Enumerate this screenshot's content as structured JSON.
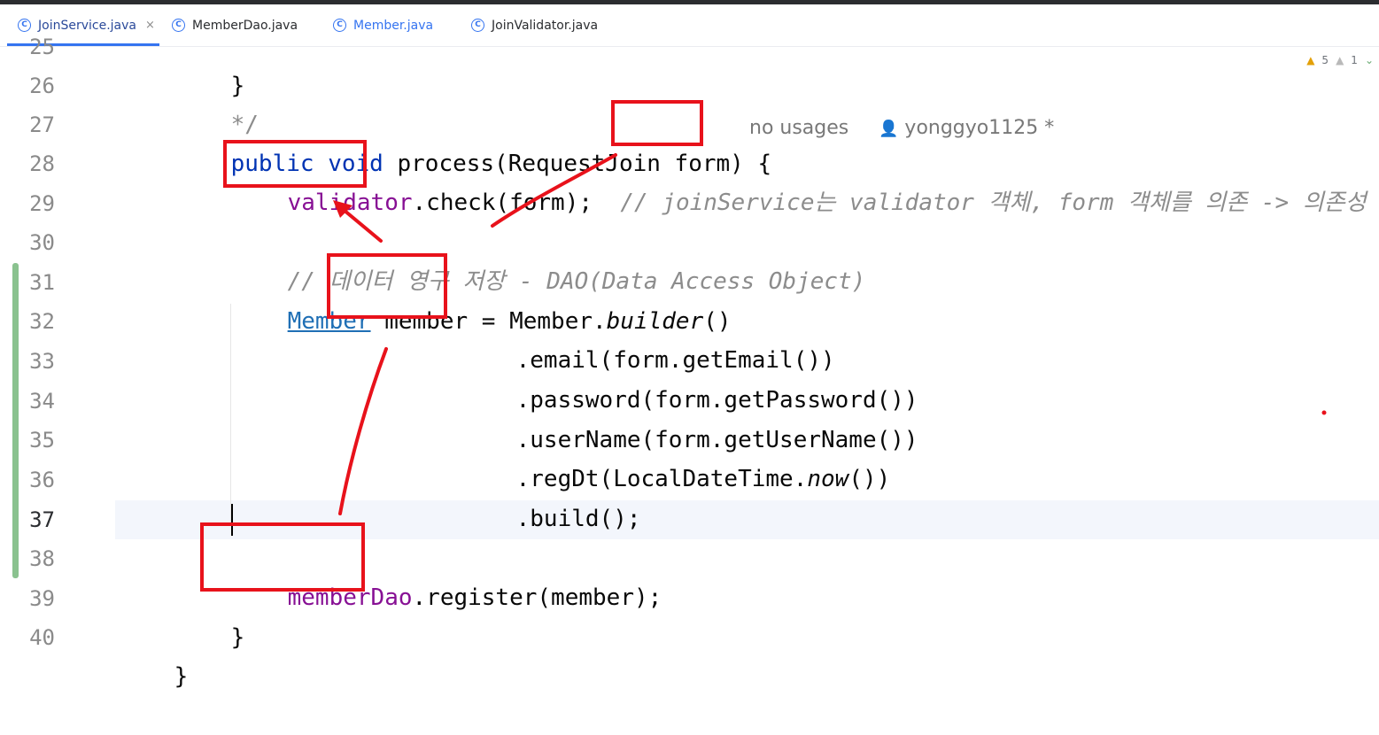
{
  "tabs": [
    {
      "label": "JoinService.java",
      "active": true
    },
    {
      "label": "MemberDao.java",
      "active": false
    },
    {
      "label": "Member.java",
      "active": false
    },
    {
      "label": "JoinValidator.java",
      "active": false
    }
  ],
  "tab_close_glyph": "×",
  "inspections": {
    "warnings": "5",
    "weak_warnings": "1"
  },
  "gutter": {
    "line_numbers": [
      "25",
      "26",
      "27",
      "28",
      "29",
      "30",
      "31",
      "32",
      "33",
      "34",
      "35",
      "36",
      "37",
      "38",
      "39",
      "40"
    ],
    "current_line": "37"
  },
  "code": {
    "l25_brace": "}",
    "l26_comment_end": "*/",
    "l27_public": "public",
    "l27_void": "void",
    "l27_signature": "process(RequestJoin form) {",
    "l27_hint_usages": "no usages",
    "l27_hint_author": "yonggyo1125 *",
    "l28_field": "validator",
    "l28_call": ".check(form);",
    "l28_comment": "// joinService는 validator 객체, form 객체를 의존 -> 의존성",
    "l30_comment": "// 데이터 영구 저장 - DAO(Data Access Object)",
    "l31_type": "Member",
    "l31_decl": " member = Member.",
    "l31_builder": "builder",
    "l31_end": "()",
    "l32": ".email(form.getEmail())",
    "l33": ".password(form.getPassword())",
    "l34": ".userName(form.getUserName())",
    "l35_start": ".regDt(LocalDateTime.",
    "l35_now": "now",
    "l35_end": "())",
    "l36": ".build();",
    "l38_field": "memberDao",
    "l38_call": ".register(member);",
    "l39_brace": "}",
    "l40_brace": "}"
  },
  "colors": {
    "annotation_red": "#e8121b",
    "keyword": "#0033b3",
    "field": "#871094",
    "comment": "#8c8c8c",
    "change_marker": "#8ac28f"
  }
}
